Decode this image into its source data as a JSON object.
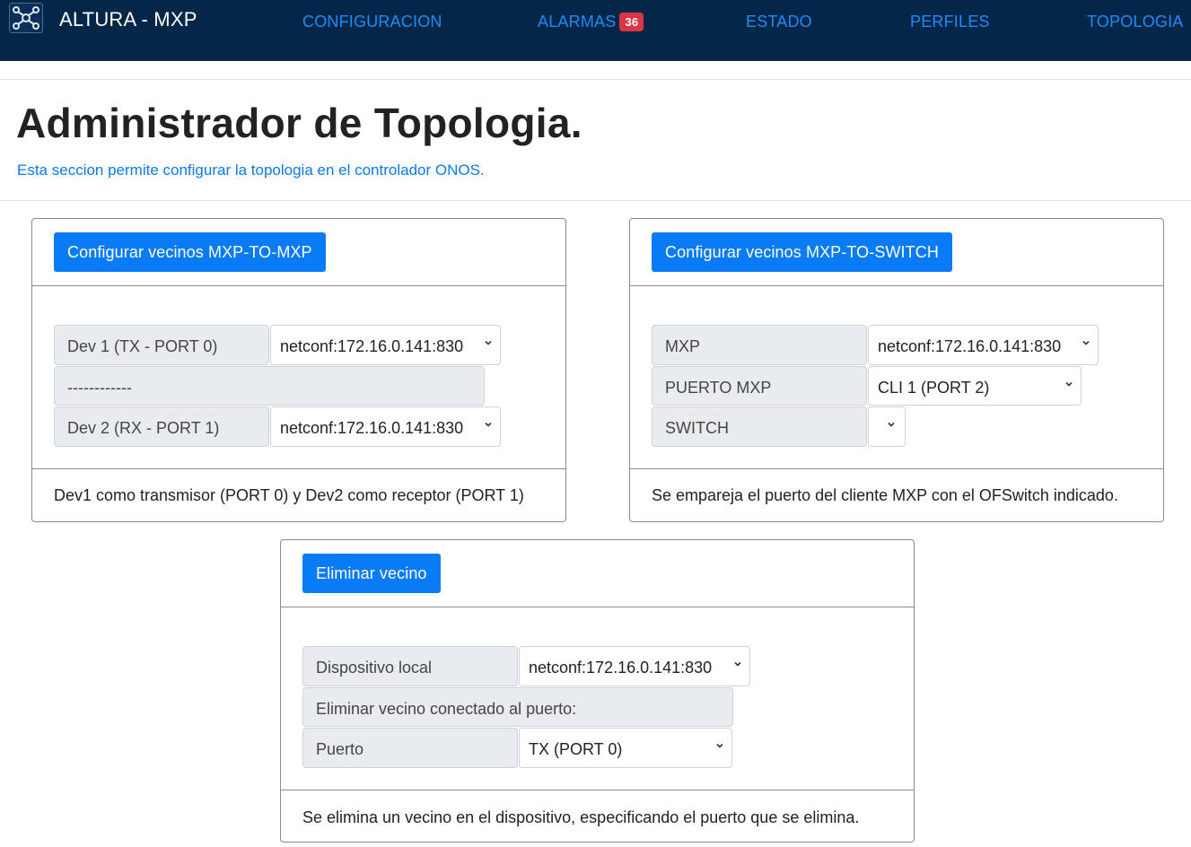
{
  "navbar": {
    "brand": "ALTURA - MXP",
    "logo_icon": "network-logo-icon",
    "links": [
      {
        "label": "CONFIGURACION"
      },
      {
        "label": "ALARMAS",
        "badge": "36"
      },
      {
        "label": "ESTADO"
      },
      {
        "label": "PERFILES"
      },
      {
        "label": "TOPOLOGIA"
      }
    ],
    "colors": {
      "background": "#052747",
      "link": "#1a8cff",
      "badge": "#dc3545"
    }
  },
  "header": {
    "title": "Administrador de Topologia.",
    "subtitle": "Esta seccion permite configurar la topologia en el controlador ONOS."
  },
  "cards": {
    "mxp_to_mxp": {
      "button": "Configurar vecinos MXP-TO-MXP",
      "dev1_label": "Dev 1 (TX - PORT 0)",
      "dev1_value": "netconf:172.16.0.141:830",
      "divider": "------------",
      "dev2_label": "Dev 2 (RX - PORT 1)",
      "dev2_value": "netconf:172.16.0.141:830",
      "footer": "Dev1 como transmisor (PORT 0) y Dev2 como receptor (PORT 1)"
    },
    "mxp_to_switch": {
      "button": "Configurar vecinos MXP-TO-SWITCH",
      "mxp_label": "MXP",
      "mxp_value": "netconf:172.16.0.141:830",
      "port_label": "PUERTO MXP",
      "port_value": "CLI 1 (PORT 2)",
      "switch_label": "SWITCH",
      "switch_value": "",
      "footer": "Se empareja el puerto del cliente MXP con el OFSwitch indicado."
    },
    "remove_neighbor": {
      "button": "Eliminar vecino",
      "device_label": "Dispositivo local",
      "device_value": "netconf:172.16.0.141:830",
      "info_label": "Eliminar vecino conectado al puerto:",
      "port_label": "Puerto",
      "port_value": "TX (PORT 0)",
      "footer": "Se elimina un vecino en el dispositivo, especificando el puerto que se elimina."
    }
  },
  "colors": {
    "primary_button": "#0a7bf7",
    "input_group_bg": "#e9ecef"
  }
}
